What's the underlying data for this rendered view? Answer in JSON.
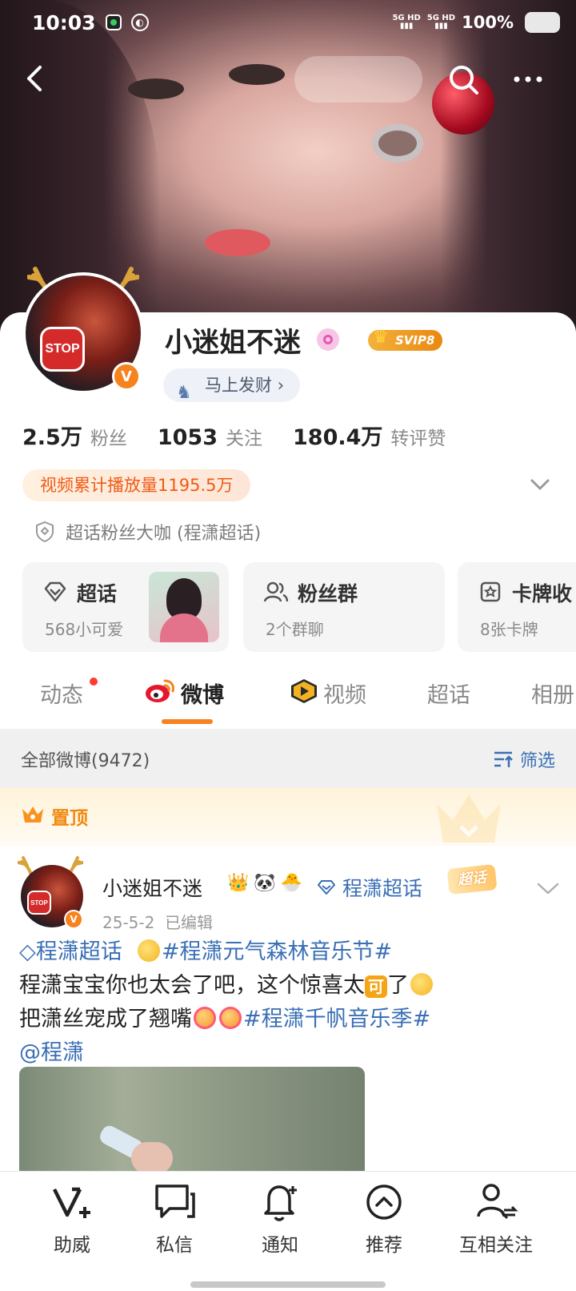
{
  "status_bar": {
    "time": "10:03",
    "network_1": "5G HD",
    "network_2": "5G HD",
    "battery": "100%"
  },
  "profile": {
    "username": "小迷姐不迷",
    "vip_badge": "SVIP8",
    "fortune_tag": "马上发财",
    "stats": [
      {
        "value": "2.5万",
        "label": "粉丝"
      },
      {
        "value": "1053",
        "label": "关注"
      },
      {
        "value": "180.4万",
        "label": "转评赞"
      }
    ],
    "views_badge": "视频累计播放量1195.5万",
    "supertopic_title": "超话粉丝大咖 (程潇超话)"
  },
  "tiles": [
    {
      "title": "超话",
      "sub": "568小可爱"
    },
    {
      "title": "粉丝群",
      "sub": "2个群聊"
    },
    {
      "title": "卡牌收",
      "sub": "8张卡牌"
    }
  ],
  "tabs": [
    {
      "label": "动态"
    },
    {
      "label": "微博"
    },
    {
      "label": "视频"
    },
    {
      "label": "超话"
    },
    {
      "label": "相册"
    }
  ],
  "filter": {
    "all_label": "全部微博(9472)",
    "filter_label": "筛选"
  },
  "pinned_label": "置顶",
  "post": {
    "author": "小迷姐不迷",
    "topic": "程潇超话",
    "badge": "超话",
    "date": "25-5-2",
    "edited": "已编辑",
    "line1_tag1": "程潇超话",
    "line1_tag2": "#程潇元气森林音乐节#",
    "line2_text_a": "程潇宝宝你也太会了吧，这个惊喜太",
    "line2_ke": "可",
    "line2_text_b": "了",
    "line3_text": "把潇丝宠成了翘嘴",
    "line3_tag": "#程潇千帆音乐季#",
    "line4_mention": "@程潇"
  },
  "bottom_bar": [
    {
      "label": "助威",
      "icon": "v-plus-icon"
    },
    {
      "label": "私信",
      "icon": "message-icon"
    },
    {
      "label": "通知",
      "icon": "bell-icon"
    },
    {
      "label": "推荐",
      "icon": "chevron-up-circle-icon"
    },
    {
      "label": "互相关注",
      "icon": "mutual-follow-icon"
    }
  ],
  "colors": {
    "accent": "#f7831e",
    "link": "#3a6fb5",
    "views_text": "#f05a16"
  }
}
